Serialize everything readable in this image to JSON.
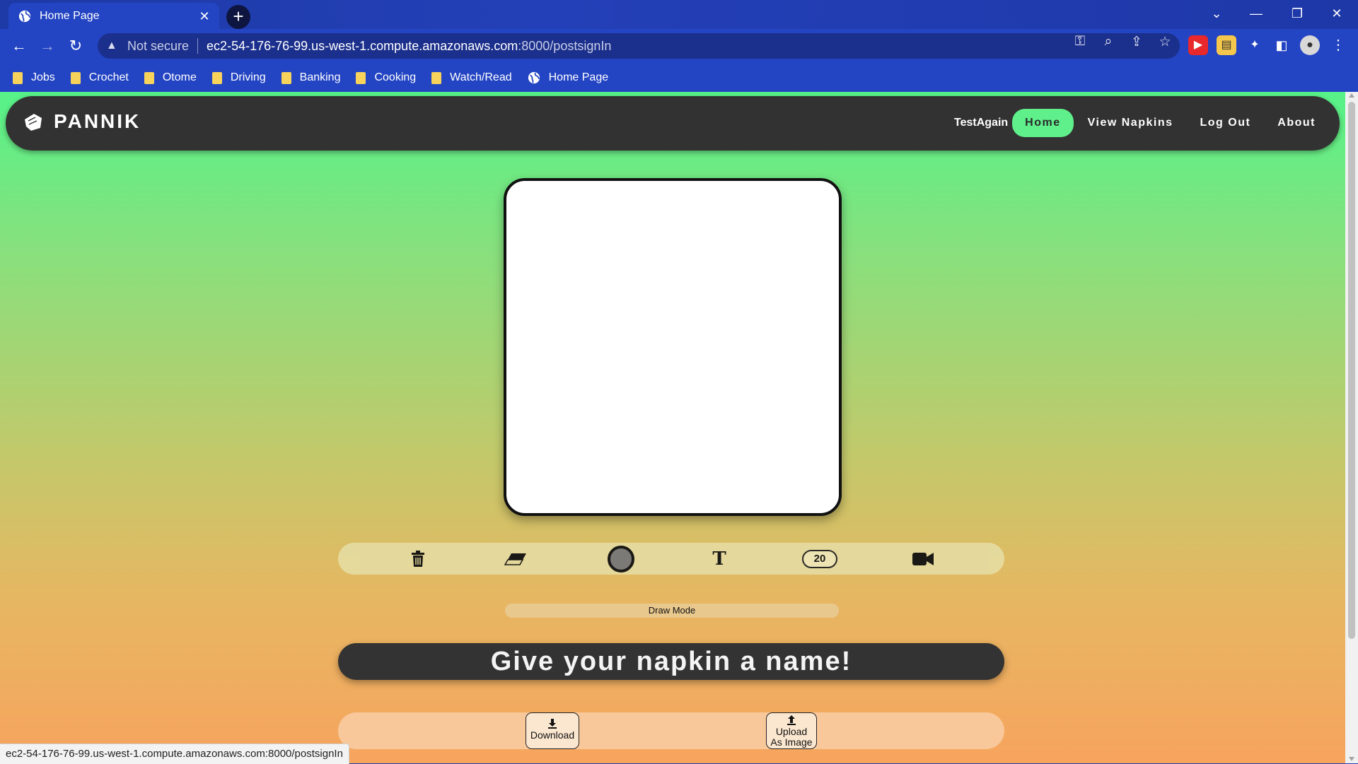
{
  "browser": {
    "tab_title": "Home Page",
    "omnibox": {
      "security_label": "Not secure",
      "url_host": "ec2-54-176-76-99.us-west-1.compute.amazonaws.com",
      "url_path": ":8000/postsignIn"
    },
    "bookmarks": [
      {
        "label": "Jobs",
        "icon": "folder-icon"
      },
      {
        "label": "Crochet",
        "icon": "folder-icon"
      },
      {
        "label": "Otome",
        "icon": "folder-icon"
      },
      {
        "label": "Driving",
        "icon": "folder-icon"
      },
      {
        "label": "Banking",
        "icon": "folder-icon"
      },
      {
        "label": "Cooking",
        "icon": "folder-icon"
      },
      {
        "label": "Watch/Read",
        "icon": "folder-icon"
      },
      {
        "label": "Home Page",
        "icon": "globe-icon"
      }
    ],
    "status_url": "ec2-54-176-76-99.us-west-1.compute.amazonaws.com:8000/postsignIn"
  },
  "app": {
    "brand": "PANNIK",
    "username": "TestAgain",
    "nav": [
      {
        "label": "Home",
        "active": true
      },
      {
        "label": "View Napkins",
        "active": false
      },
      {
        "label": "Log Out",
        "active": false
      },
      {
        "label": "About",
        "active": false
      }
    ],
    "tools": {
      "brush_size": "20",
      "mode_label": "Draw Mode"
    },
    "name_prompt": "Give your napkin a name!",
    "actions": {
      "download": "Download",
      "upload_line1": "Upload",
      "upload_line2": "As Image"
    }
  },
  "colors": {
    "accent": "#5ff08c",
    "nav_bg": "#323232",
    "gradient_top": "#56f389",
    "gradient_bottom": "#f7a45e"
  }
}
